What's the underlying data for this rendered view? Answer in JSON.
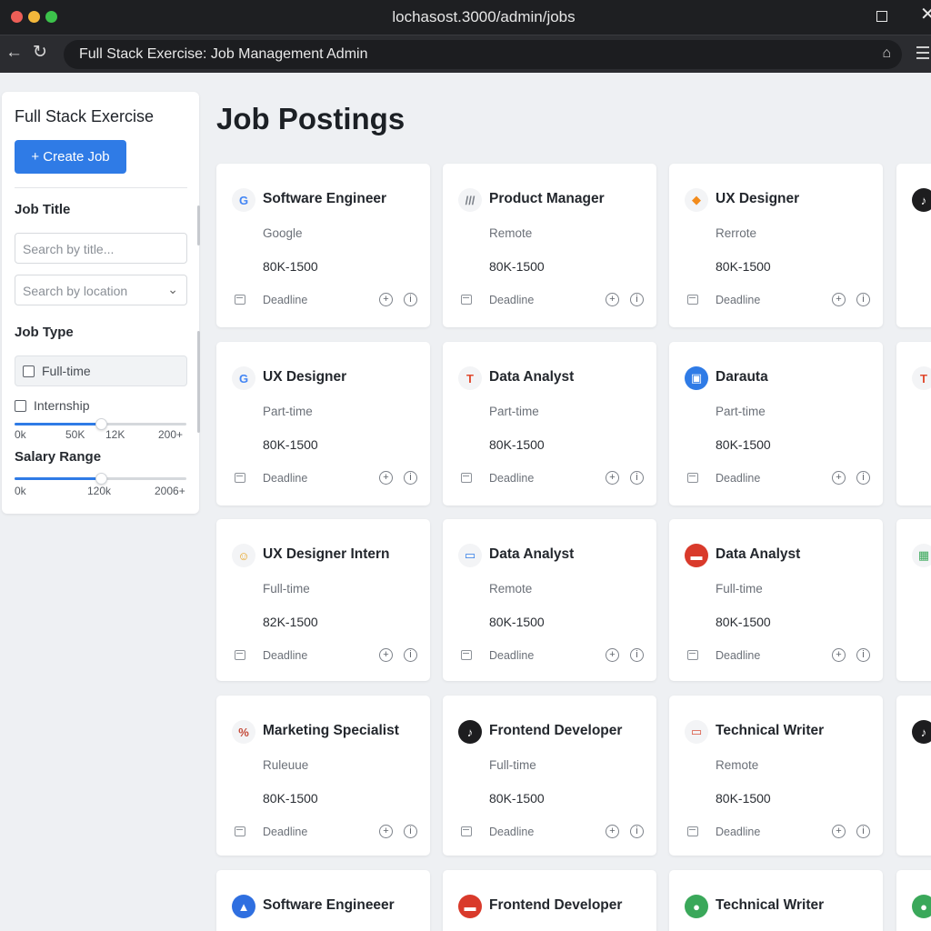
{
  "browser": {
    "url": "lochasost.3000/admin/jobs",
    "tab_title": "Full Stack Exercise: Job Management Admin"
  },
  "icons": {
    "back": "arrow-left-icon",
    "reload": "reload-icon",
    "site": "shield-star-icon",
    "menu": "hamburger-menu-icon",
    "calendar": "calendar-icon",
    "action_1": "add-circle-icon",
    "action_2": "info-circle-icon"
  },
  "colors": {
    "accent": "#2f7be6",
    "chrome": "#1e1f22",
    "page_bg": "#eef0f3"
  },
  "sidebar": {
    "title": "Full Stack Exercise",
    "create_button": "+ Create Job",
    "job_title_label": "Job Title",
    "title_search_placeholder": "Search by title...",
    "location_search_placeholder": "Search by location",
    "job_type_label": "Job Type",
    "job_types": [
      "Full-time",
      "Internship"
    ],
    "range_slider": {
      "ticks": [
        "0k",
        "50K",
        "12K",
        "200+"
      ],
      "value_fraction": 0.5
    },
    "salary_label": "Salary Range",
    "salary_slider": {
      "ticks": [
        "0k",
        "120k",
        "2006+"
      ],
      "value_fraction": 0.5
    }
  },
  "main": {
    "title": "Job Postings",
    "cards": [
      {
        "title": "Software Engineer",
        "type": "Google",
        "salary": "80K-1500",
        "deadline": "Deadline",
        "logo": "G"
      },
      {
        "title": "Product Manager",
        "type": "Remote",
        "salary": "80K-1500",
        "deadline": "Deadline",
        "logo": "///"
      },
      {
        "title": "UX Designer",
        "type": "Rerrote",
        "salary": "80K-1500",
        "deadline": "Deadline",
        "logo": "◆"
      },
      {
        "title": "",
        "type": "",
        "salary": "",
        "deadline": "",
        "logo": "♪"
      },
      {
        "title": "UX Designer",
        "type": "Part-time",
        "salary": "80K-1500",
        "deadline": "Deadline",
        "logo": "G"
      },
      {
        "title": "Data Analyst",
        "type": "Part-time",
        "salary": "80K-1500",
        "deadline": "Deadline",
        "logo": "T"
      },
      {
        "title": "Darauta",
        "type": "Part-time",
        "salary": "80K-1500",
        "deadline": "Deadline",
        "logo": "▣"
      },
      {
        "title": "",
        "type": "",
        "salary": "",
        "deadline": "",
        "logo": "T"
      },
      {
        "title": "UX Designer Intern",
        "type": "Full-time",
        "salary": "82K-1500",
        "deadline": "Deadline",
        "logo": "☺"
      },
      {
        "title": "Data Analyst",
        "type": "Remote",
        "salary": "80K-1500",
        "deadline": "Deadline",
        "logo": "▭"
      },
      {
        "title": "Data Analyst",
        "type": "Full-time",
        "salary": "80K-1500",
        "deadline": "Deadline",
        "logo": "▬"
      },
      {
        "title": "",
        "type": "",
        "salary": "",
        "deadline": "",
        "logo": "▦"
      },
      {
        "title": "Marketing Specialist",
        "type": "Ruleuue",
        "salary": "80K-1500",
        "deadline": "Deadline",
        "logo": "%"
      },
      {
        "title": "Frontend Developer",
        "type": "Full-time",
        "salary": "80K-1500",
        "deadline": "Deadline",
        "logo": "♪"
      },
      {
        "title": "Technical Writer",
        "type": "Remote",
        "salary": "80K-1500",
        "deadline": "Deadline",
        "logo": "▭"
      },
      {
        "title": "",
        "type": "",
        "salary": "",
        "deadline": "",
        "logo": "♪"
      },
      {
        "title": "Software Engineeer",
        "type": "",
        "salary": "",
        "deadline": "",
        "logo": "▲"
      },
      {
        "title": "Frontend Developer",
        "type": "",
        "salary": "",
        "deadline": "",
        "logo": "▬"
      },
      {
        "title": "Technical Writer",
        "type": "",
        "salary": "",
        "deadline": "",
        "logo": "●"
      },
      {
        "title": "",
        "type": "",
        "salary": "",
        "deadline": "",
        "logo": "●"
      }
    ]
  }
}
